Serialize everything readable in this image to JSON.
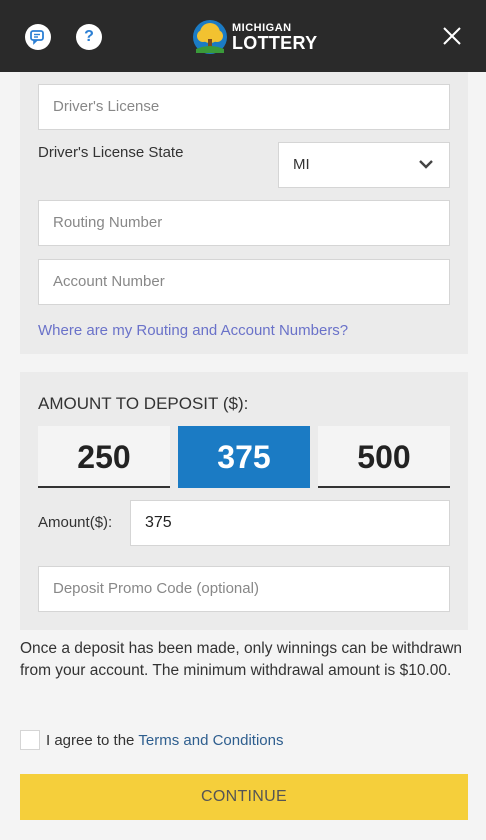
{
  "header": {
    "logo_top": "MICHIGAN",
    "logo_bottom": "LOTTERY",
    "icons": [
      "chat-icon",
      "help-icon",
      "close-icon"
    ]
  },
  "bank_form": {
    "drivers_license_placeholder": "Driver's License",
    "drivers_license_state_label": "Driver's License State",
    "state_value": "MI",
    "routing_placeholder": "Routing Number",
    "account_placeholder": "Account Number",
    "routing_help_link": "Where are my Routing and Account Numbers?"
  },
  "deposit": {
    "title": "AMOUNT TO DEPOSIT ($):",
    "options": [
      "250",
      "375",
      "500"
    ],
    "selected": "375",
    "amount_label": "Amount($):",
    "amount_value": "375",
    "promo_placeholder": "Deposit Promo Code (optional)"
  },
  "notice": "Once a deposit has been made, only winnings can be withdrawn from your account. The minimum withdrawal amount is $10.00.",
  "agree": {
    "text": "I agree to the",
    "link": "Terms and Conditions"
  },
  "continue_label": "CONTINUE",
  "colors": {
    "selected_amount": "#1b7bc4",
    "continue_button": "#f5cf3b",
    "link": "#6a72c9"
  }
}
